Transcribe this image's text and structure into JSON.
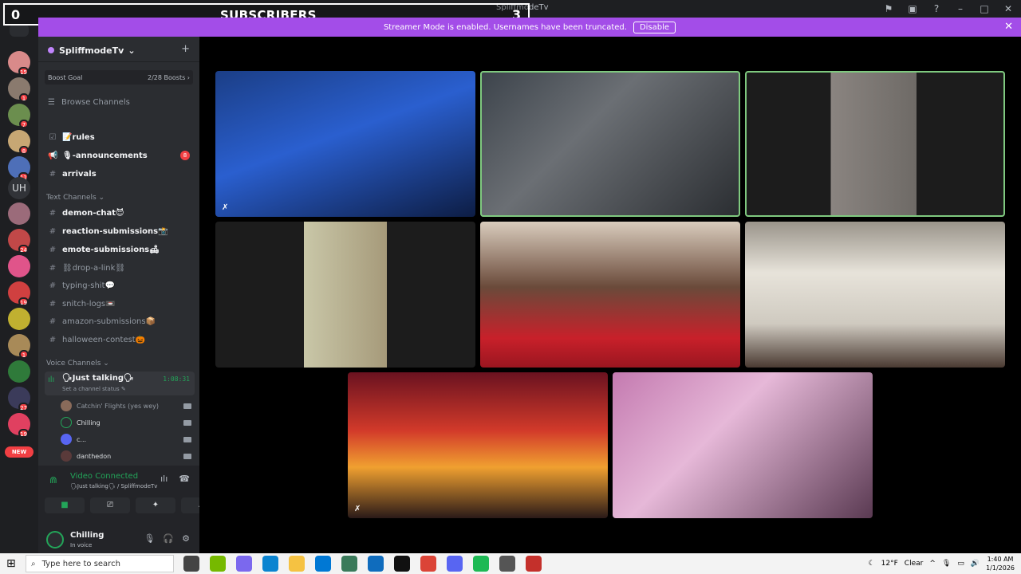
{
  "titlebar": {
    "title": "SpliffmodeTv",
    "icons": [
      "flag-icon",
      "inbox-icon",
      "help-icon",
      "minimize-icon",
      "maximize-icon",
      "close-icon"
    ]
  },
  "overlay": {
    "left_value": "0",
    "label": "SUBSCRIBERS",
    "right_value": "3"
  },
  "banner": {
    "message": "Streamer Mode is enabled. Usernames have been truncated.",
    "button": "Disable",
    "close": "✕"
  },
  "guilds": {
    "badges": [
      "15",
      "1",
      "7",
      "8",
      "11",
      "24",
      "19",
      "1",
      "27",
      "19"
    ],
    "text_guild": "UH",
    "new_label": "NEW"
  },
  "server": {
    "name": "SpliffmodeTv",
    "chevron": "⌄",
    "add_member": "+"
  },
  "boost": {
    "label": "Boost Goal",
    "progress": "2/28 Boosts",
    "arrow": "›"
  },
  "browse": {
    "label": "Browse Channels"
  },
  "channels_top": [
    {
      "name": "📝rules",
      "icon": "☑"
    },
    {
      "name": "🎙-announcements",
      "icon": "📢",
      "badge": "8"
    },
    {
      "name": "arrivals",
      "icon": "#"
    }
  ],
  "text_channels": {
    "label": "Text Channels ⌄",
    "items": [
      {
        "name": "demon-chat😈",
        "bright": true
      },
      {
        "name": "reaction-submissions📸",
        "bright": true
      },
      {
        "name": "emote-submissions🛋",
        "bright": true
      },
      {
        "name": "⛓drop-a-link⛓",
        "bright": false
      },
      {
        "name": "typing-shit💬",
        "bright": false
      },
      {
        "name": "snitch-logs📼",
        "bright": false
      },
      {
        "name": "amazon-submissions📦",
        "bright": false
      },
      {
        "name": "halloween-contest🎃",
        "bright": false
      }
    ]
  },
  "voice": {
    "label": "Voice Channels ⌄",
    "channel_name": "🗣Just talking🗣",
    "time": "1:08:31",
    "status": "Set a channel status ✎",
    "users": [
      "Catchin' Flights (yes wey)",
      "Chilling",
      "c...",
      "danthedon"
    ]
  },
  "panel": {
    "connected": "Video Connected",
    "location": "🗣Just talking🗣 / SpliffmodeTv",
    "buttons": [
      "camera-icon",
      "screen-share-icon",
      "activities-icon",
      "soundboard-icon"
    ]
  },
  "user": {
    "name": "Chilling",
    "status": "In voice"
  },
  "taskbar": {
    "search_placeholder": "Type here to search",
    "weather_temp": "12°F",
    "weather_desc": "Clear",
    "time": "1:40 AM",
    "date": "1/1/2026"
  },
  "colors": {
    "accent": "#a34de8",
    "online": "#23a559",
    "mention": "#f23f43",
    "speaking": "#7fc97f"
  }
}
